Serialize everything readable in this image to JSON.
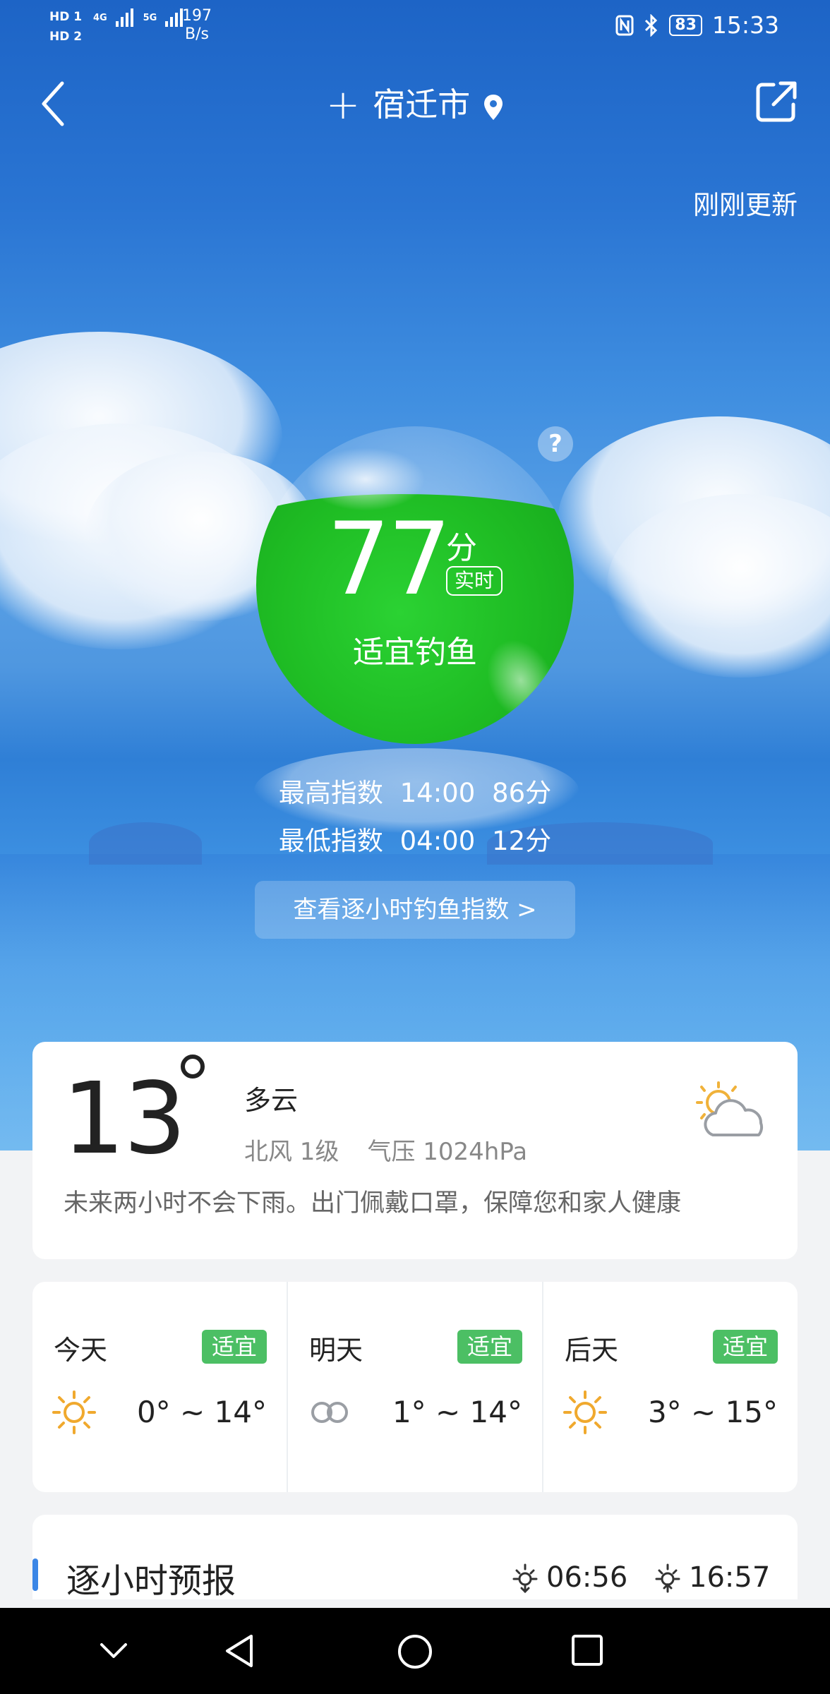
{
  "status_bar": {
    "sim1": "HD 1",
    "sim2": "HD 2",
    "net1": "4G",
    "net2": "5G",
    "speed_value": "197",
    "speed_unit": "B/s",
    "battery": "83",
    "time": "15:33"
  },
  "header": {
    "plus": "+",
    "city": "宿迁市",
    "updated": "刚刚更新"
  },
  "index": {
    "score": "77",
    "unit": "分",
    "realtime": "实时",
    "verdict": "适宜钓鱼",
    "help": "?",
    "max_label": "最高指数",
    "max_time": "14:00",
    "max_score": "86分",
    "min_label": "最低指数",
    "min_time": "04:00",
    "min_score": "12分",
    "hourly_button": "查看逐小时钓鱼指数  >"
  },
  "current": {
    "temperature": "13",
    "condition": "多云",
    "wind": "北风  1级",
    "pressure": "气压  1024hPa",
    "advice": "未来两小时不会下雨。出门佩戴口罩，保障您和家人健康",
    "icon": "partly-cloudy-icon"
  },
  "forecast": [
    {
      "day": "今天",
      "badge": "适宜",
      "range": "0° ~ 14°",
      "icon": "sun-icon"
    },
    {
      "day": "明天",
      "badge": "适宜",
      "range": "1° ~ 14°",
      "icon": "haze-icon"
    },
    {
      "day": "后天",
      "badge": "适宜",
      "range": "3° ~ 15°",
      "icon": "sun-icon"
    }
  ],
  "hourly": {
    "title": "逐小时预报",
    "sunrise": "06:56",
    "sunset": "16:57"
  },
  "colors": {
    "sky": "#2a75d3",
    "bubble_green": "#1fbd24",
    "badge_green": "#4cbf64",
    "accent_blue": "#3b86e6"
  }
}
